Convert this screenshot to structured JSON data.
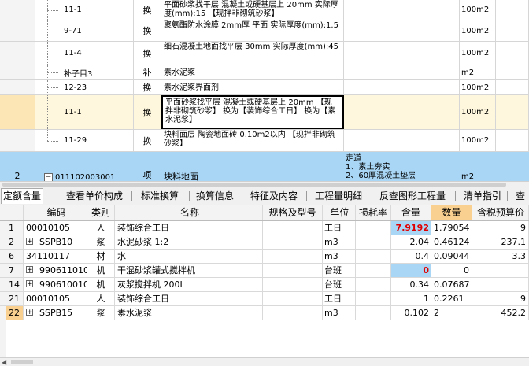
{
  "top_rows": [
    {
      "idx": "",
      "code": "11-1",
      "type": "换",
      "name": "平面砂浆找平层 混凝土或硬基层上 20mm 实际厚度(mm):15 【现拌非砌筑砂浆】",
      "unit": "100m2"
    },
    {
      "idx": "",
      "code": "9-71",
      "type": "换",
      "name": "聚氨酯防水涂膜 2mm厚 平面 实际厚度(mm):1.5",
      "unit": "100m2"
    },
    {
      "idx": "",
      "code": "11-4",
      "type": "换",
      "name": "细石混凝土地面找平层 30mm 实际厚度(mm):45",
      "unit": "100m2"
    },
    {
      "idx": "",
      "code": "补子目3",
      "type": "补",
      "name": "素水泥浆",
      "unit": "m2"
    },
    {
      "idx": "",
      "code": "12-23",
      "type": "换",
      "name": "素水泥浆界面剂",
      "unit": "100m2"
    },
    {
      "idx": "",
      "code": "11-1",
      "type": "换",
      "name": "平面砂浆找平层 混凝土或硬基层上 20mm 【现拌非砌筑砂浆】 换为【装饰综合工日】 换为【素水泥浆】",
      "unit": "100m2"
    },
    {
      "idx": "",
      "code": "11-29",
      "type": "换",
      "name": "块料面层 陶瓷地面砖 0.10m2以内 【现拌非砌筑砂浆】",
      "unit": "100m2"
    },
    {
      "idx": "2",
      "code": "011102003001",
      "type": "项",
      "name": "块料地面",
      "feature": "走道\n1、素土夯实\n2、60厚混凝土垫层",
      "unit": "m2"
    }
  ],
  "tabs": [
    "定额含量",
    "查看单价构成",
    "标准换算",
    "换算信息",
    "特征及内容",
    "工程量明细",
    "反查图形工程量",
    "清单指引",
    "查"
  ],
  "columns": [
    "编码",
    "类别",
    "名称",
    "规格及型号",
    "单位",
    "损耗率",
    "含量",
    "数量",
    "含税预算价"
  ],
  "rows": [
    {
      "n": "1",
      "code": "00010105",
      "cat": "人",
      "name": "装饰综合工日",
      "spec": "",
      "unit": "工日",
      "loss": "",
      "content": "7.9192",
      "qty": "1.79054",
      "price": "9"
    },
    {
      "n": "2",
      "code": "SSPB10",
      "cat": "浆",
      "name": "水泥砂浆 1:2",
      "spec": "",
      "unit": "m3",
      "loss": "",
      "content": "2.04",
      "qty": "0.46124",
      "price": "237.1"
    },
    {
      "n": "6",
      "code": "34110117",
      "cat": "材",
      "name": "水",
      "spec": "",
      "unit": "m3",
      "loss": "",
      "content": "0.4",
      "qty": "0.09044",
      "price": "3.3"
    },
    {
      "n": "7",
      "code": "990611010",
      "cat": "机",
      "name": "干混砂浆罐式搅拌机",
      "spec": "",
      "unit": "台班",
      "loss": "",
      "content": "0",
      "qty": "0",
      "price": ""
    },
    {
      "n": "14",
      "code": "990610010",
      "cat": "机",
      "name": "灰浆搅拌机 200L",
      "spec": "",
      "unit": "台班",
      "loss": "",
      "content": "0.34",
      "qty": "0.07687",
      "price": ""
    },
    {
      "n": "21",
      "code": "00010105",
      "cat": "人",
      "name": "装饰综合工日",
      "spec": "",
      "unit": "工日",
      "loss": "",
      "content": "1",
      "qty": "0.2261",
      "price": "9"
    },
    {
      "n": "22",
      "code": "SSPB15",
      "cat": "浆",
      "name": "素水泥浆",
      "spec": "",
      "unit": "m3",
      "loss": "",
      "content": "0.102",
      "qty": "2",
      "price": "452.2"
    }
  ],
  "expand_glyph": "+",
  "collapse_glyph": "−"
}
